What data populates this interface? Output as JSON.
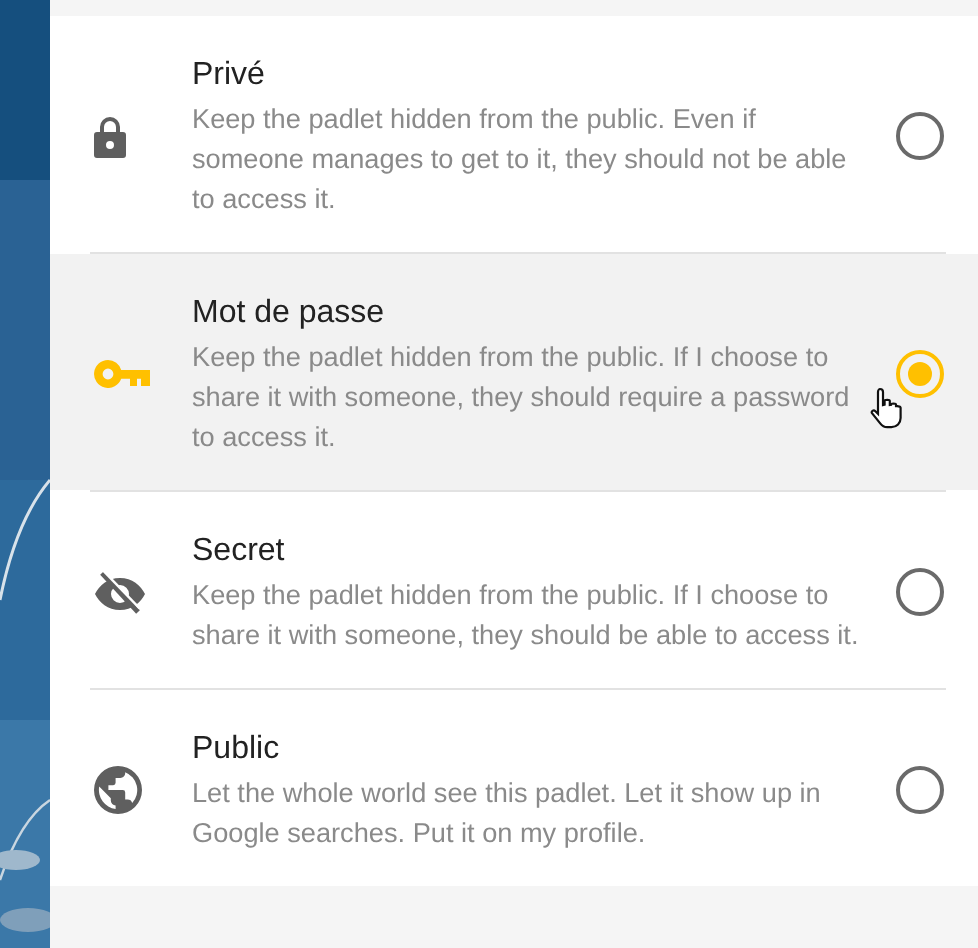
{
  "options": [
    {
      "kind": "lock",
      "title": "Privé",
      "description": "Keep the padlet hidden from the public. Even if someone manages to get to it, they should not be able to access it.",
      "selected": false
    },
    {
      "kind": "key",
      "title": "Mot de passe",
      "description": "Keep the padlet hidden from the public. If I choose to share it with someone, they should require a password to access it.",
      "selected": true
    },
    {
      "kind": "hidden",
      "title": "Secret",
      "description": "Keep the padlet hidden from the public. If I choose to share it with someone, they should be able to access it.",
      "selected": false
    },
    {
      "kind": "globe",
      "title": "Public",
      "description": "Let the whole world see this padlet. Let it show up in Google searches. Put it on my profile.",
      "selected": false
    }
  ]
}
